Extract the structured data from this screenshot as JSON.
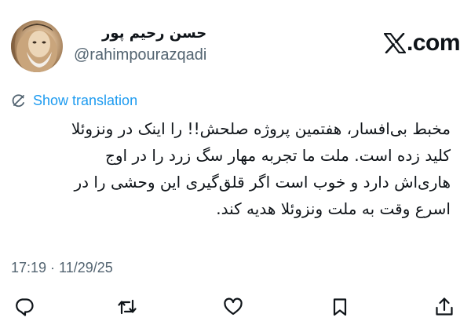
{
  "author": {
    "display_name": "حسن رحیم پور",
    "handle": "@rahimpourazqadi"
  },
  "brand": {
    "label": ".com",
    "logo_icon": "x-logo-icon"
  },
  "translation": {
    "label": "Show translation",
    "icon": "translate-icon"
  },
  "tweet": {
    "text": "مخبط بی‌افسار، هفتمین پروژه صلحش!! را اینک در ونزوئلا\nکلید زده است. ملت ما تجربه مهار سگ زرد را در اوج\nهاری‌اش دارد و خوب است اگر قلق‌گیری این وحشی را در\nاسرع وقت به ملت ونزوئلا هدیه کند.",
    "timestamp": "17:19 · 11/29/25"
  },
  "actions": [
    {
      "name": "reply",
      "icon": "reply-icon"
    },
    {
      "name": "repost",
      "icon": "repost-icon"
    },
    {
      "name": "like",
      "icon": "heart-icon"
    },
    {
      "name": "bookmark",
      "icon": "bookmark-icon"
    },
    {
      "name": "share",
      "icon": "share-icon"
    }
  ],
  "colors": {
    "text": "#0f1419",
    "secondary": "#536471",
    "link": "#1d9bf0"
  }
}
